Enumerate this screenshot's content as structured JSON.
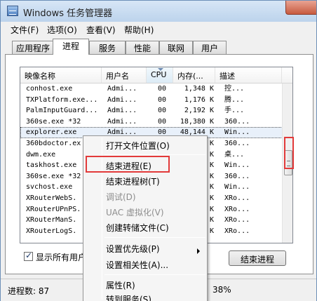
{
  "title": "Windows 任务管理器",
  "menu": [
    "文件(F)",
    "选项(O)",
    "查看(V)",
    "帮助(H)"
  ],
  "tabs": [
    "应用程序",
    "进程",
    "服务",
    "性能",
    "联网",
    "用户"
  ],
  "columns": [
    "映像名称",
    "用户名",
    "CPU",
    "内存(...",
    "描述"
  ],
  "rows": [
    {
      "name": "conhost.exe",
      "user": "Admi...",
      "cpu": "00",
      "mem": "1,348 K",
      "desc": "控..."
    },
    {
      "name": "TXPlatform.exe...",
      "user": "Admi...",
      "cpu": "00",
      "mem": "1,176 K",
      "desc": "腾..."
    },
    {
      "name": "PalmInputGuard...",
      "user": "Admi...",
      "cpu": "00",
      "mem": "2,192 K",
      "desc": "手..."
    },
    {
      "name": "360se.exe *32",
      "user": "Admi...",
      "cpu": "00",
      "mem": "18,380 K",
      "desc": "360..."
    },
    {
      "name": "explorer.exe",
      "user": "Admi...",
      "cpu": "00",
      "mem": "48,144 K",
      "desc": "Win..."
    },
    {
      "name": "360bdoctor.ex",
      "user": "",
      "cpu": "",
      "mem": "K",
      "desc": "360..."
    },
    {
      "name": "dwm.exe",
      "user": "",
      "cpu": "",
      "mem": "K",
      "desc": "桌..."
    },
    {
      "name": "taskhost.exe",
      "user": "",
      "cpu": "",
      "mem": "K",
      "desc": "Win..."
    },
    {
      "name": "360se.exe *32",
      "user": "",
      "cpu": "",
      "mem": "K",
      "desc": "360..."
    },
    {
      "name": "svchost.exe",
      "user": "",
      "cpu": "",
      "mem": "K",
      "desc": "Win..."
    },
    {
      "name": "XRouterWebS.",
      "user": "",
      "cpu": "",
      "mem": "K",
      "desc": "XRo..."
    },
    {
      "name": "XRouterUPnPS.",
      "user": "",
      "cpu": "",
      "mem": "K",
      "desc": "XRo..."
    },
    {
      "name": "XRouterManS.",
      "user": "",
      "cpu": "",
      "mem": "K",
      "desc": "XRo..."
    },
    {
      "name": "XRouterLogS.",
      "user": "",
      "cpu": "",
      "mem": "K",
      "desc": "XRo..."
    }
  ],
  "show_all_users_label": "显示所有用户",
  "end_process_button": "结束进程",
  "status": {
    "processes": "进程数: 87",
    "cpu_usage": "38%"
  },
  "context_menu": {
    "open_location": "打开文件位置(O)",
    "end_process": "结束进程(E)",
    "end_process_tree": "结束进程树(T)",
    "debug": "调试(D)",
    "uac_virtualize": "UAC 虚拟化(V)",
    "create_dump": "创建转储文件(C)",
    "set_priority": "设置优先级(P)",
    "set_affinity": "设置相关性(A)...",
    "properties": "属性(R)",
    "go_to_service": "转到服务(S)"
  },
  "colors": {
    "highlight_box": "#e23a3a",
    "title_bar": "#c4d8ee"
  },
  "icons": [
    "task-manager-icon",
    "close-icon",
    "sort-arrow-icon",
    "checkbox-checked-icon",
    "submenu-arrow-icon"
  ]
}
